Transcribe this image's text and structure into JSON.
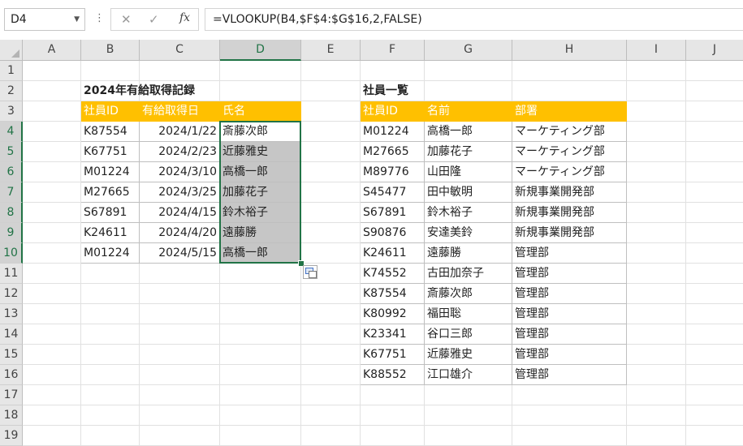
{
  "formula_bar": {
    "name_box": "D4",
    "cancel_glyph": "✕",
    "enter_glyph": "✓",
    "fx_label": "fx",
    "formula": "=VLOOKUP(B4,$F$4:$G$16,2,FALSE)"
  },
  "columns": [
    "A",
    "B",
    "C",
    "D",
    "E",
    "F",
    "G",
    "H",
    "I",
    "J"
  ],
  "rows": [
    "1",
    "2",
    "3",
    "4",
    "5",
    "6",
    "7",
    "8",
    "9",
    "10",
    "11",
    "12",
    "13",
    "14",
    "15",
    "16",
    "17",
    "18",
    "19"
  ],
  "selected_column": "D",
  "selected_rows": [
    "4",
    "5",
    "6",
    "7",
    "8",
    "9",
    "10"
  ],
  "table1": {
    "title": "2024年有給取得記録",
    "headers": [
      "社員ID",
      "有給取得日",
      "氏名"
    ],
    "rows": [
      [
        "K87554",
        "2024/1/22",
        "斎藤次郎"
      ],
      [
        "K67751",
        "2024/2/23",
        "近藤雅史"
      ],
      [
        "M01224",
        "2024/3/10",
        "高橋一郎"
      ],
      [
        "M27665",
        "2024/3/25",
        "加藤花子"
      ],
      [
        "S67891",
        "2024/4/15",
        "鈴木裕子"
      ],
      [
        "K24611",
        "2024/4/20",
        "遠藤勝"
      ],
      [
        "M01224",
        "2024/5/15",
        "高橋一郎"
      ]
    ]
  },
  "table2": {
    "title": "社員一覧",
    "headers": [
      "社員ID",
      "名前",
      "部署"
    ],
    "rows": [
      [
        "M01224",
        "高橋一郎",
        "マーケティング部"
      ],
      [
        "M27665",
        "加藤花子",
        "マーケティング部"
      ],
      [
        "M89776",
        "山田隆",
        "マーケティング部"
      ],
      [
        "S45477",
        "田中敏明",
        "新規事業開発部"
      ],
      [
        "S67891",
        "鈴木裕子",
        "新規事業開発部"
      ],
      [
        "S90876",
        "安達美鈴",
        "新規事業開発部"
      ],
      [
        "K24611",
        "遠藤勝",
        "管理部"
      ],
      [
        "K74552",
        "古田加奈子",
        "管理部"
      ],
      [
        "K87554",
        "斎藤次郎",
        "管理部"
      ],
      [
        "K80992",
        "福田聡",
        "管理部"
      ],
      [
        "K23341",
        "谷口三郎",
        "管理部"
      ],
      [
        "K67751",
        "近藤雅史",
        "管理部"
      ],
      [
        "K88552",
        "江口雄介",
        "管理部"
      ]
    ]
  },
  "colors": {
    "header_fill": "#ffc000",
    "selection": "#217346",
    "selected_fill": "#c6c6c6"
  }
}
